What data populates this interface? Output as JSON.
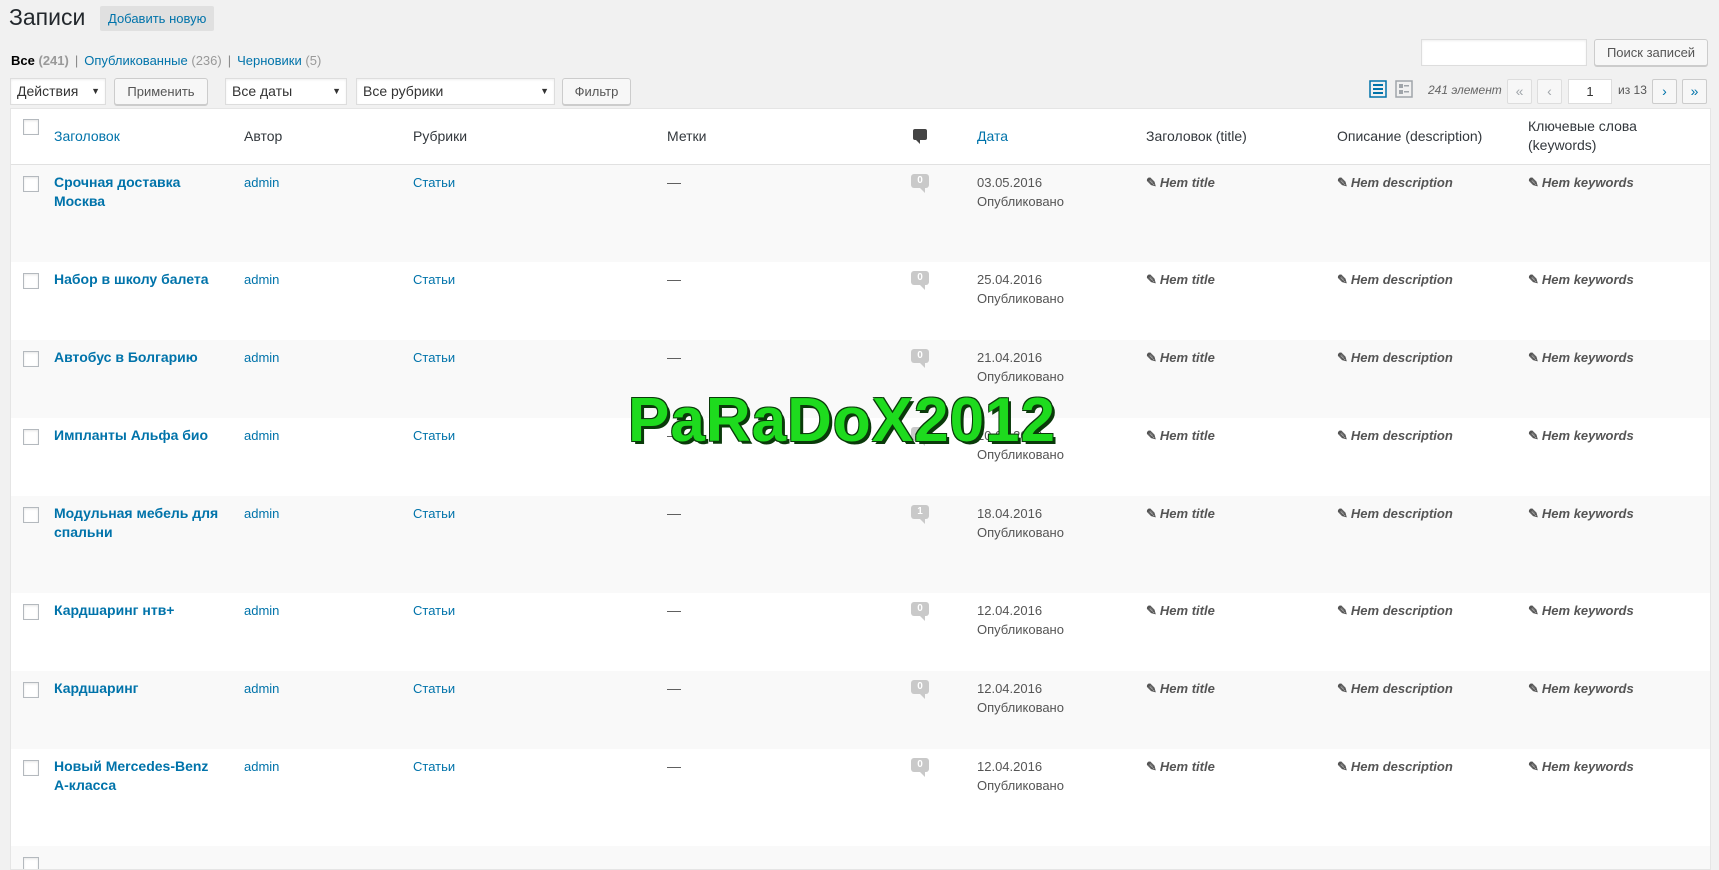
{
  "header": {
    "title": "Записи",
    "add_new": "Добавить новую"
  },
  "views": {
    "all": {
      "label": "Все",
      "count": "(241)"
    },
    "published": {
      "label": "Опубликованные",
      "count": "(236)"
    },
    "drafts": {
      "label": "Черновики",
      "count": "(5)"
    },
    "separator": "|"
  },
  "search": {
    "value": "",
    "button": "Поиск записей"
  },
  "filters": {
    "bulk_action": "Действия",
    "apply": "Применить",
    "dates": "Все даты",
    "categories": "Все рубрики",
    "filter_button": "Фильтр"
  },
  "pagination": {
    "count_text": "241 элемент",
    "first": "«",
    "prev": "‹",
    "current_page": "1",
    "of_text": "из 13",
    "next": "›",
    "last": "»"
  },
  "columns": {
    "title": "Заголовок",
    "author": "Автор",
    "categories": "Рубрики",
    "tags": "Метки",
    "date": "Дата",
    "seo_title": "Заголовок (title)",
    "seo_description": "Описание (description)",
    "seo_keywords_1": "Ключевые слова",
    "seo_keywords_2": "(keywords)"
  },
  "posts": [
    {
      "title_1": "Срочная доставка",
      "title_2": "Москва",
      "author": "admin",
      "category": "Статьи",
      "tags": "—",
      "comments": "0",
      "date": "03.05.2016",
      "status": "Опубликовано",
      "seo_title": "Нет title",
      "seo_description": "Нет description",
      "seo_keywords": "Нет keywords"
    },
    {
      "title_1": "Набор в школу балета",
      "title_2": "",
      "author": "admin",
      "category": "Статьи",
      "tags": "—",
      "comments": "0",
      "date": "25.04.2016",
      "status": "Опубликовано",
      "seo_title": "Нет title",
      "seo_description": "Нет description",
      "seo_keywords": "Нет keywords"
    },
    {
      "title_1": "Автобус в Болгарию",
      "title_2": "",
      "author": "admin",
      "category": "Статьи",
      "tags": "—",
      "comments": "0",
      "date": "21.04.2016",
      "status": "Опубликовано",
      "seo_title": "Нет title",
      "seo_description": "Нет description",
      "seo_keywords": "Нет keywords"
    },
    {
      "title_1": "Импланты Альфа био",
      "title_2": "",
      "author": "admin",
      "category": "Статьи",
      "tags": "—",
      "comments": "0",
      "date": "20.04.2016",
      "status": "Опубликовано",
      "seo_title": "Нет title",
      "seo_description": "Нет description",
      "seo_keywords": "Нет keywords"
    },
    {
      "title_1": "Модульная мебель для",
      "title_2": "спальни",
      "author": "admin",
      "category": "Статьи",
      "tags": "—",
      "comments": "1",
      "date": "18.04.2016",
      "status": "Опубликовано",
      "seo_title": "Нет title",
      "seo_description": "Нет description",
      "seo_keywords": "Нет keywords"
    },
    {
      "title_1": "Кардшаринг нтв+",
      "title_2": "",
      "author": "admin",
      "category": "Статьи",
      "tags": "—",
      "comments": "0",
      "date": "12.04.2016",
      "status": "Опубликовано",
      "seo_title": "Нет title",
      "seo_description": "Нет description",
      "seo_keywords": "Нет keywords"
    },
    {
      "title_1": "Кардшаринг",
      "title_2": "",
      "author": "admin",
      "category": "Статьи",
      "tags": "—",
      "comments": "0",
      "date": "12.04.2016",
      "status": "Опубликовано",
      "seo_title": "Нет title",
      "seo_description": "Нет description",
      "seo_keywords": "Нет keywords"
    },
    {
      "title_1": "Новый Mercedes-Benz",
      "title_2": "A-класса",
      "author": "admin",
      "category": "Статьи",
      "tags": "—",
      "comments": "0",
      "date": "12.04.2016",
      "status": "Опубликовано",
      "seo_title": "Нет title",
      "seo_description": "Нет description",
      "seo_keywords": "Нет keywords"
    }
  ],
  "watermark": "PaRaDoX2012",
  "colors": {
    "link": "#0073aa",
    "watermark": "#1edb1e",
    "background": "#f1f1f1"
  }
}
